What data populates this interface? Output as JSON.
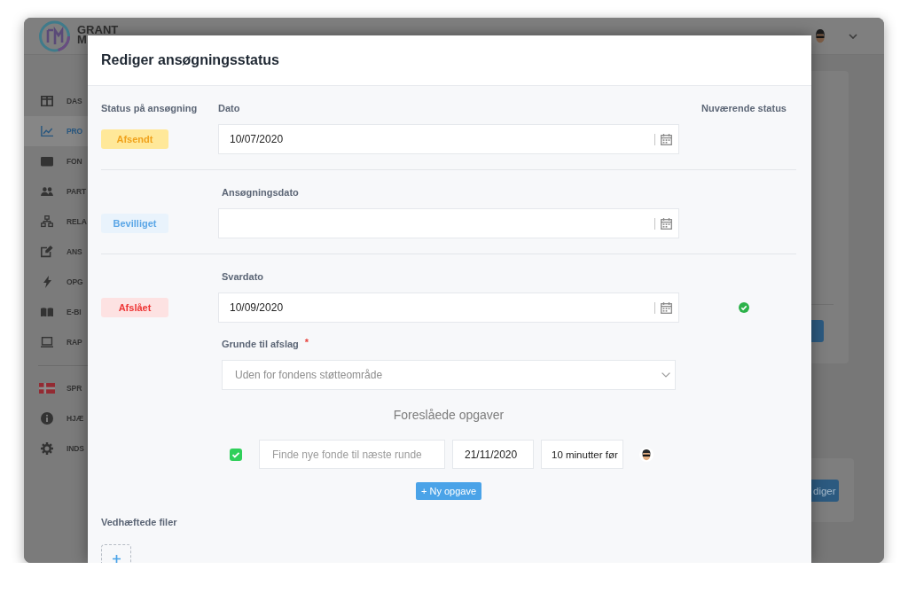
{
  "app": {
    "logo_text": [
      "GRANT",
      "M"
    ],
    "sidebar": {
      "items": [
        {
          "label": "DAS",
          "selected": false
        },
        {
          "label": "PRO",
          "selected": true
        },
        {
          "label": "FON",
          "selected": false
        },
        {
          "label": "PART",
          "selected": false
        },
        {
          "label": "RELA",
          "selected": false
        },
        {
          "label": "ANS",
          "selected": false
        },
        {
          "label": "OPG",
          "selected": false
        },
        {
          "label": "E-BI",
          "selected": false
        },
        {
          "label": "RAP",
          "selected": false
        }
      ],
      "footer_items": [
        {
          "label": "SPR",
          "selected": false
        },
        {
          "label": "HJÆ",
          "selected": false
        },
        {
          "label": "INDS",
          "selected": false
        }
      ]
    },
    "content": {
      "edit_button": "diger"
    }
  },
  "modal": {
    "title": "Rediger ansøgningsstatus",
    "columns": {
      "status": "Status på ansøgning",
      "current": "Nuværende status"
    },
    "statuses": [
      {
        "badge": "Afsendt",
        "kind": "sent",
        "date_label": "Dato",
        "date_value": "10/07/2020",
        "current": false
      },
      {
        "badge": "Bevilliget",
        "kind": "granted",
        "date_label": "Ansøgningsdato",
        "current": false
      },
      {
        "badge": "Afslået",
        "kind": "rejected",
        "date_label": "Svardato",
        "date_value": "10/09/2020",
        "current": true,
        "reason": {
          "label": "Grunde til afslag",
          "required_mark": "*",
          "placeholder": "Uden for fondens støtteområde"
        },
        "suggested_tasks": {
          "title": "Foreslåede opgaver",
          "tasks": [
            {
              "checked": true,
              "placeholder": "Finde nye fonde til næste runde",
              "date": "21/11/2020",
              "reminder": "10 minutter før"
            }
          ],
          "add_button": "+ Ny opgave"
        }
      }
    ],
    "attachments": {
      "label": "Vedhæftede filer"
    }
  }
}
